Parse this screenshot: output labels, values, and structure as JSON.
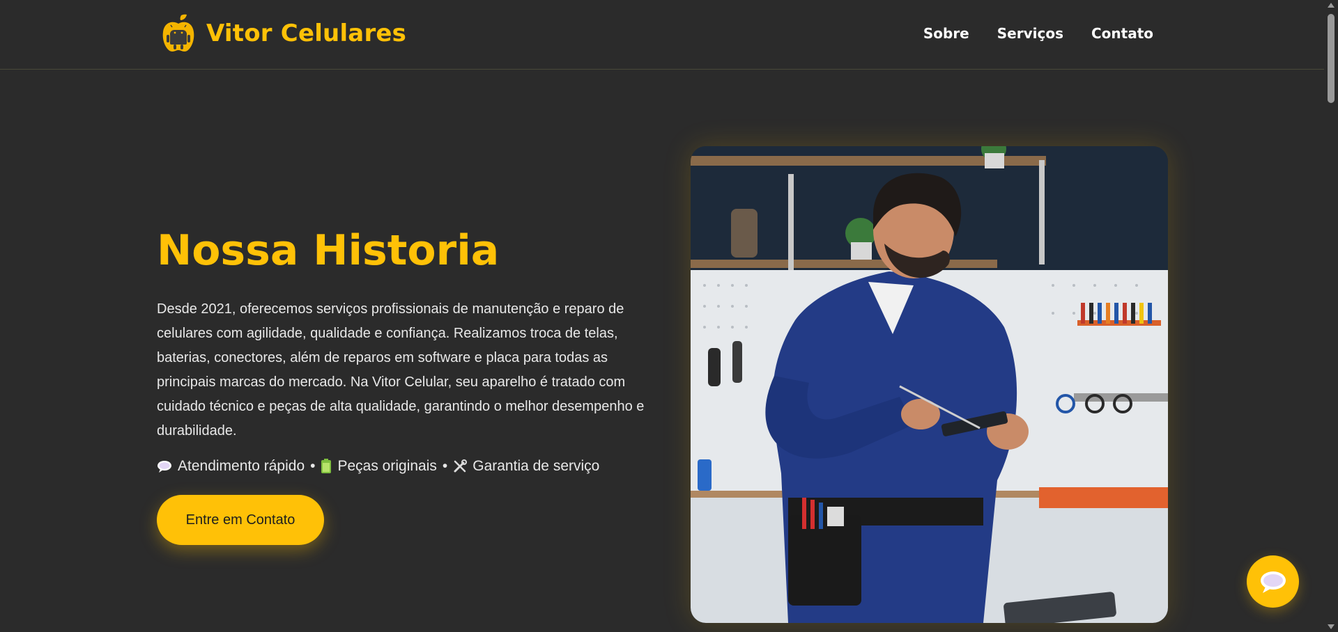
{
  "header": {
    "brand_name": "Vitor Celulares",
    "logo_icon": "apple-android-logo-icon",
    "nav": [
      {
        "label": "Sobre"
      },
      {
        "label": "Serviços"
      },
      {
        "label": "Contato"
      }
    ]
  },
  "hero": {
    "title": "Nossa Historia",
    "description": "Desde 2021, oferecemos serviços profissionais de manutenção e reparo de celulares com agilidade, qualidade e confiança. Realizamos troca de telas, baterias, conectores, além de reparos em software e placa para todas as principais marcas do mercado. Na Vitor Celular, seu aparelho é tratado com cuidado técnico e peças de alta qualidade, garantindo o melhor desempenho e durabilidade.",
    "features": [
      {
        "icon": "speech-bubble-icon",
        "label": "Atendimento rápido"
      },
      {
        "icon": "battery-icon",
        "label": "Peças originais"
      },
      {
        "icon": "tools-icon",
        "label": "Garantia de serviço"
      }
    ],
    "separator": "•",
    "cta_label": "Entre em Contato",
    "image_icon": "technician-repairing-phone-image"
  },
  "chat": {
    "icon": "chat-bubble-icon"
  },
  "colors": {
    "accent": "#ffc107",
    "background": "#2b2b2b",
    "text": "#e8e8e8"
  }
}
